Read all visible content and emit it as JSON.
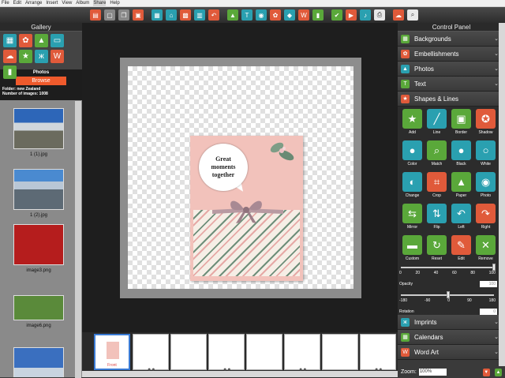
{
  "menu": [
    "File",
    "Edit",
    "Arrange",
    "Insert",
    "View",
    "Album",
    "Share",
    "Help"
  ],
  "gallery": {
    "title": "Gallery",
    "photos_heading": "Photos",
    "browse_label": "Browse",
    "folder_text": "Folder: new Zealand",
    "count_text": "Number of images: 1008",
    "thumbs": [
      "1 (1).jpg",
      "1 (2).jpg",
      "image3.png",
      "image6.png"
    ]
  },
  "card": {
    "bubble_line1": "Great",
    "bubble_line2": "moments",
    "bubble_line3": "together"
  },
  "control": {
    "title": "Control Panel",
    "sections": [
      "Backgrounds",
      "Embellishments",
      "Photos",
      "Text",
      "Shapes & Lines"
    ],
    "tools": [
      "Add",
      "Line",
      "Border",
      "Shadow",
      "Color",
      "Match",
      "Black",
      "White",
      "Change",
      "Crop",
      "Paper",
      "Photo",
      "Mirror",
      "Flip",
      "Left",
      "Right",
      "Custom",
      "Reset",
      "Edit",
      "Remove"
    ],
    "opacity_label": "Opacity",
    "opacity_value": "100",
    "opacity_ticks": [
      "0",
      "20",
      "40",
      "60",
      "80",
      "100"
    ],
    "rotation_label": "Rotation",
    "rotation_value": "0",
    "rotation_ticks": [
      "-180",
      "-90",
      "0",
      "90",
      "180"
    ],
    "bottom_sections": [
      "Imprints",
      "Calendars",
      "Word Art"
    ]
  },
  "strip": {
    "front_label": "Front"
  },
  "zoom": {
    "label": "Zoom:",
    "value": "100%"
  }
}
